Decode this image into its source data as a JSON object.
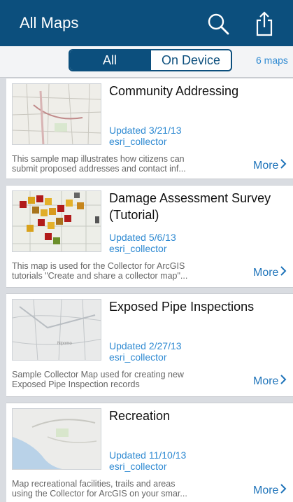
{
  "header": {
    "title": "All Maps",
    "icons": {
      "search": "search-icon",
      "share": "share-icon"
    }
  },
  "filter": {
    "all_label": "All",
    "on_device_label": "On Device",
    "count": "6 maps"
  },
  "maps": [
    {
      "title": "Community Addressing",
      "updated": "Updated 3/21/13",
      "owner": "esri_collector",
      "description_line1": "This sample map illustrates how citizens can",
      "description_line2": "submit proposed addresses and contact inf...",
      "more_label": "More"
    },
    {
      "title": "Damage Assessment Survey (Tutorial)",
      "updated": "Updated 5/6/13",
      "owner": "esri_collector",
      "description_line1": "This map is used for the Collector for ArcGIS",
      "description_line2": "tutorials \"Create and share a collector map\"...",
      "more_label": "More"
    },
    {
      "title": "Exposed Pipe Inspections",
      "updated": "Updated 2/27/13",
      "owner": "esri_collector",
      "description_line1": "Sample Collector Map used for creating new",
      "description_line2": "Exposed Pipe Inspection records",
      "more_label": "More"
    },
    {
      "title": "Recreation",
      "updated": "Updated 11/10/13",
      "owner": "esri_collector",
      "description_line1": "Map recreational facilities, trails and areas",
      "description_line2": "using the Collector for ArcGIS on your smar...",
      "more_label": "More"
    }
  ],
  "colors": {
    "nav": "#0c4f7d",
    "link": "#2f8ad2",
    "background": "#d9dce1"
  }
}
